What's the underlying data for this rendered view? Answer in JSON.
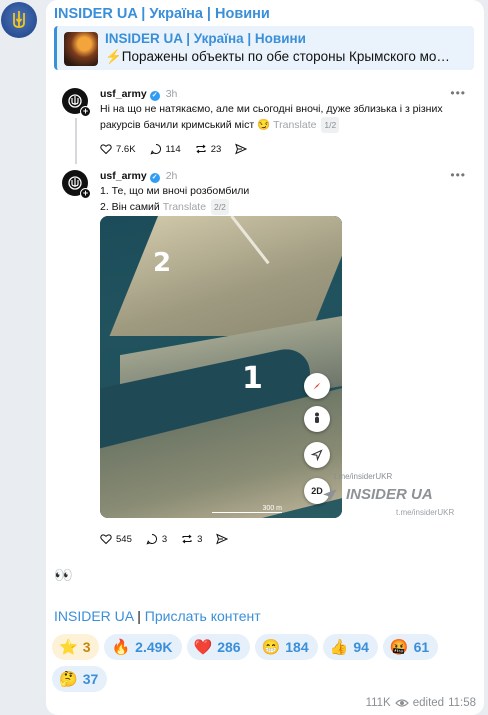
{
  "channel": {
    "name": "INSIDER UA | Україна | Новини"
  },
  "reply": {
    "title": "INSIDER UA | Україна | Новини",
    "text": "⚡️Поражены объекты по обе стороны Крымского мо…"
  },
  "posts": [
    {
      "username": "usf_army",
      "time": "3h",
      "text": "Ні на що не натякаємо, але ми сьогодні вночі, дуже зблизька і з різних ракурсів бачили кримський міст 😏",
      "translate": "Translate",
      "page": "1/2",
      "likes": "7.6K",
      "comments": "114",
      "reposts": "23"
    },
    {
      "username": "usf_army",
      "time": "2h",
      "line1": "1. Те, що ми вночі розбомбили",
      "line2": "2. Він самий",
      "translate": "Translate",
      "page": "2/2",
      "photo_label_2": "2",
      "photo_label_1": "1",
      "map_mode": "2D",
      "scale": "300 m",
      "likes": "545",
      "comments": "3",
      "reposts": "3"
    }
  ],
  "watermark": {
    "top": "t.me/insiderUKR",
    "logo": "INSIDER UA",
    "bottom": "t.me/insiderUKR"
  },
  "emoji_line": "👀",
  "footer": {
    "link1": "INSIDER UA",
    "separator": "|",
    "link2": "Прислать контент"
  },
  "reactions": [
    {
      "emoji": "⭐",
      "count": "3",
      "type": "star"
    },
    {
      "emoji": "🔥",
      "count": "2.49K"
    },
    {
      "emoji": "❤️",
      "count": "286"
    },
    {
      "emoji": "😁",
      "count": "184"
    },
    {
      "emoji": "👍",
      "count": "94"
    },
    {
      "emoji": "🤬",
      "count": "61"
    },
    {
      "emoji": "🤔",
      "count": "37"
    }
  ],
  "meta": {
    "views": "111K",
    "edited": "edited",
    "time": "11:58"
  },
  "colors": {
    "link": "#3a8fd9",
    "background": "#e9edf2",
    "bubble": "#ffffff"
  }
}
